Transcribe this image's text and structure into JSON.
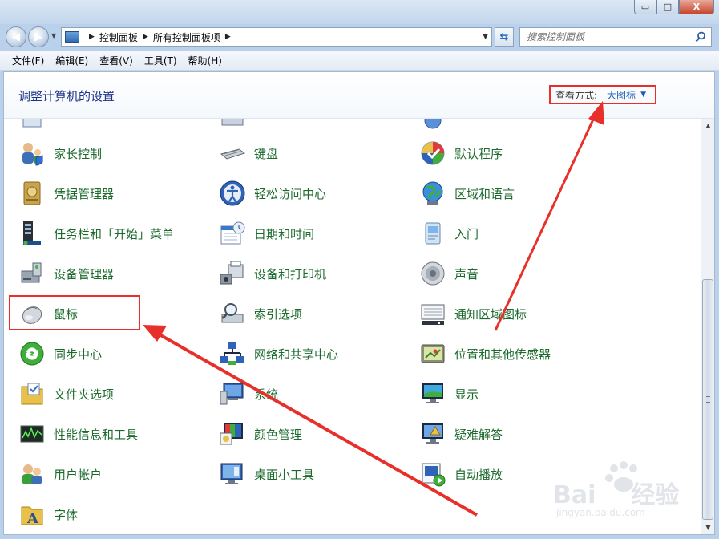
{
  "window": {
    "controls": {
      "minimize": "▭",
      "maximize": "□",
      "close": "X"
    }
  },
  "nav": {
    "breadcrumb": [
      "控制面板",
      "所有控制面板项"
    ],
    "search_placeholder": "搜索控制面板"
  },
  "menu": [
    "文件(F)",
    "编辑(E)",
    "查看(V)",
    "工具(T)",
    "帮助(H)"
  ],
  "header": {
    "title": "调整计算机的设置",
    "view_by_label": "查看方式:",
    "view_by_value": "大图标"
  },
  "items": {
    "col1": [
      {
        "label": "家长控制",
        "icon": "parental-controls-icon"
      },
      {
        "label": "凭据管理器",
        "icon": "credential-manager-icon"
      },
      {
        "label": "任务栏和「开始」菜单",
        "icon": "taskbar-icon"
      },
      {
        "label": "设备管理器",
        "icon": "device-manager-icon"
      },
      {
        "label": "鼠标",
        "icon": "mouse-icon"
      },
      {
        "label": "同步中心",
        "icon": "sync-center-icon"
      },
      {
        "label": "文件夹选项",
        "icon": "folder-options-icon"
      },
      {
        "label": "性能信息和工具",
        "icon": "performance-icon"
      },
      {
        "label": "用户帐户",
        "icon": "user-accounts-icon"
      },
      {
        "label": "字体",
        "icon": "fonts-icon"
      }
    ],
    "col2": [
      {
        "label": "键盘",
        "icon": "keyboard-icon"
      },
      {
        "label": "轻松访问中心",
        "icon": "ease-of-access-icon"
      },
      {
        "label": "日期和时间",
        "icon": "date-time-icon"
      },
      {
        "label": "设备和打印机",
        "icon": "devices-printers-icon"
      },
      {
        "label": "索引选项",
        "icon": "indexing-icon"
      },
      {
        "label": "网络和共享中心",
        "icon": "network-icon"
      },
      {
        "label": "系统",
        "icon": "system-icon"
      },
      {
        "label": "颜色管理",
        "icon": "color-management-icon"
      },
      {
        "label": "桌面小工具",
        "icon": "gadgets-icon"
      }
    ],
    "col3": [
      {
        "label": "默认程序",
        "icon": "default-programs-icon"
      },
      {
        "label": "区域和语言",
        "icon": "region-language-icon"
      },
      {
        "label": "入门",
        "icon": "getting-started-icon"
      },
      {
        "label": "声音",
        "icon": "sound-icon"
      },
      {
        "label": "通知区域图标",
        "icon": "notification-icons-icon"
      },
      {
        "label": "位置和其他传感器",
        "icon": "location-sensors-icon"
      },
      {
        "label": "显示",
        "icon": "display-icon"
      },
      {
        "label": "疑难解答",
        "icon": "troubleshooting-icon"
      },
      {
        "label": "自动播放",
        "icon": "autoplay-icon"
      }
    ]
  },
  "watermark": {
    "brand": "Bai",
    "brand_cn": "经验",
    "url": "jingyan.baidu.com"
  },
  "colors": {
    "highlight": "#e8302a",
    "link_green": "#1b6a2c",
    "title_blue": "#1e3287"
  }
}
